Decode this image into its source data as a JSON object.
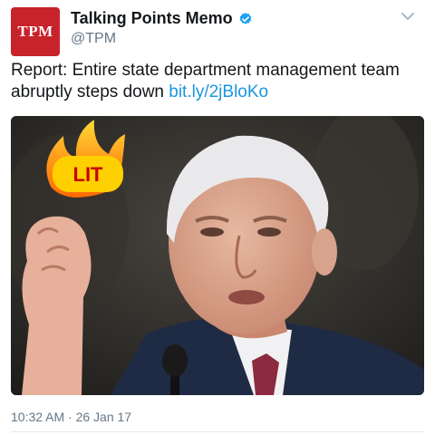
{
  "author": {
    "avatar_text": "TPM",
    "name": "Talking Points Memo",
    "handle": "@TPM",
    "verified": true
  },
  "tweet": {
    "text": "Report: Entire state department management team abruptly steps down ",
    "link": "bit.ly/2jBloKo",
    "timestamp": "10:32 AM · 26 Jan 17"
  },
  "media": {
    "emoji_label": "LIT"
  },
  "colors": {
    "avatar_bg": "#c8222b",
    "link": "#1b95e0",
    "verified": "#1da1f2",
    "muted": "#657786"
  },
  "icons": {
    "verified": "verified-badge-icon",
    "caret": "chevron-down-icon",
    "fire": "fire-icon"
  }
}
